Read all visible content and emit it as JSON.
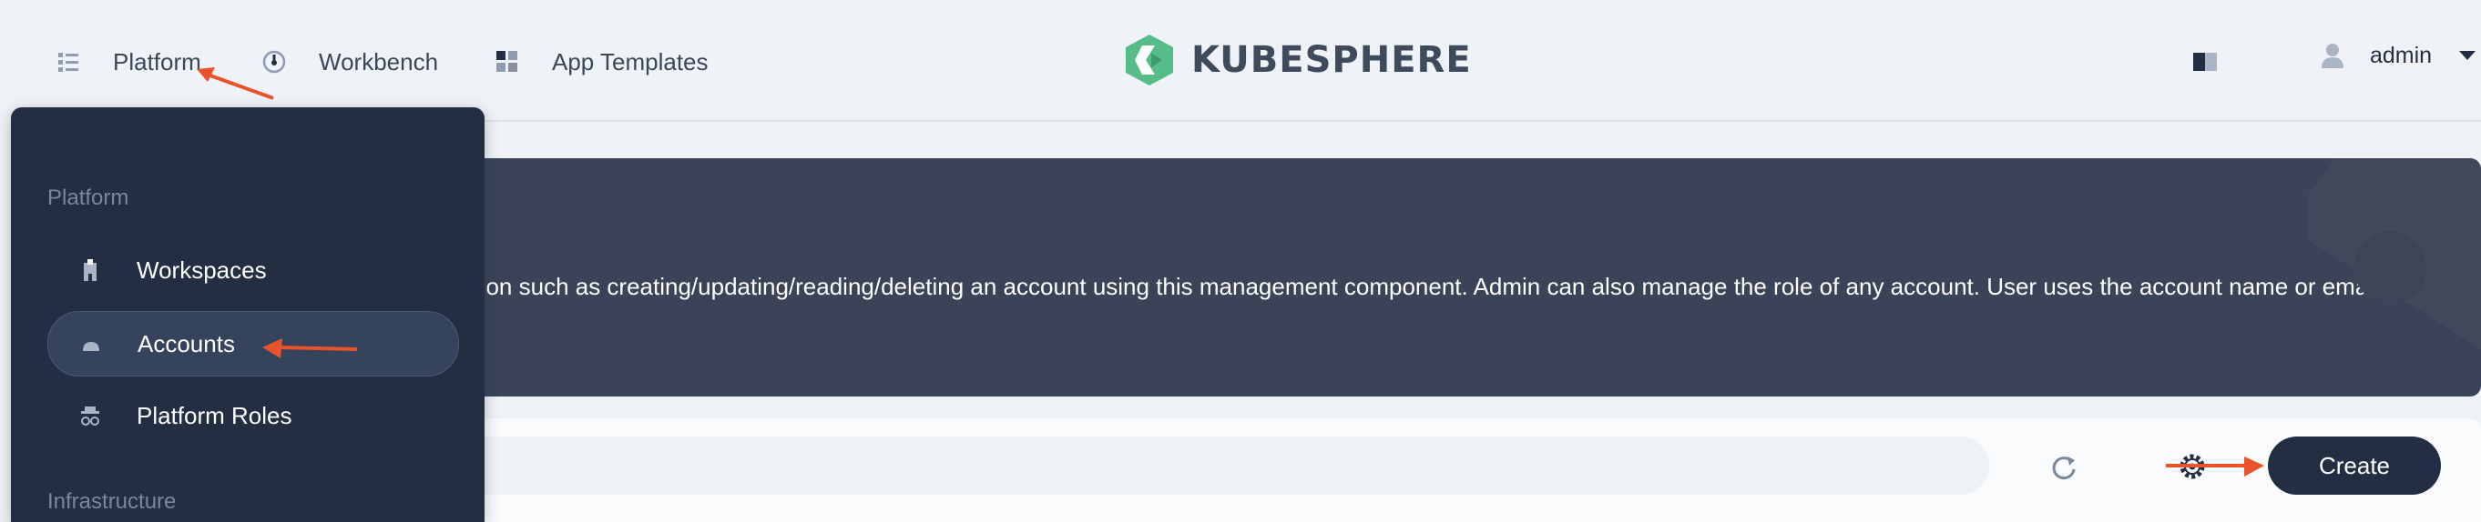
{
  "nav": {
    "items": [
      {
        "label": "Platform",
        "icon": "list-icon"
      },
      {
        "label": "Workbench",
        "icon": "dashboard-icon"
      },
      {
        "label": "App Templates",
        "icon": "grid-icon"
      }
    ]
  },
  "logo": {
    "text": "KUBESPHERE",
    "color": "#55bc8a"
  },
  "user": {
    "name": "admin"
  },
  "banner": {
    "description": "ation such as creating/updating/reading/deleting an account using this management component. Admin can also manage the role of any account. User uses the account name or email to"
  },
  "toolbar": {
    "create_label": "Create"
  },
  "sidebar": {
    "section_platform": "Platform",
    "items": [
      {
        "label": "Workspaces",
        "icon": "workspace-icon"
      },
      {
        "label": "Accounts",
        "icon": "account-icon",
        "active": true
      },
      {
        "label": "Platform Roles",
        "icon": "role-icon"
      }
    ],
    "section_infrastructure": "Infrastructure"
  },
  "colors": {
    "accent_dark": "#242e42",
    "annotation": "#e8532b",
    "banner": "#3a4358"
  }
}
